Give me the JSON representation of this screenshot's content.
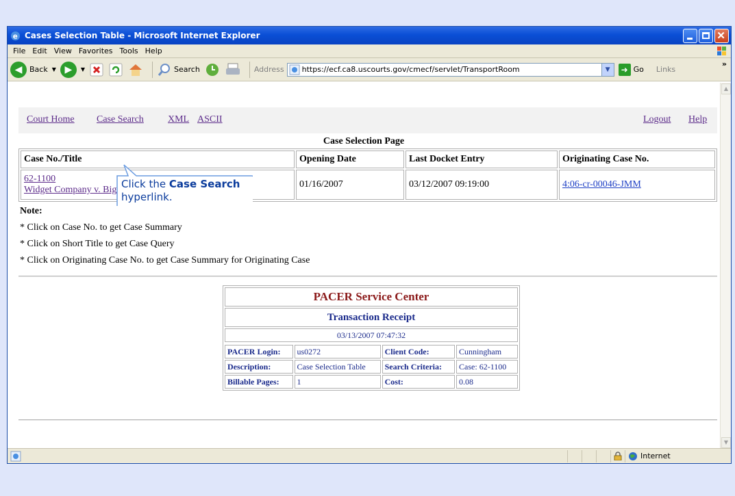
{
  "window": {
    "title": "Cases Selection Table - Microsoft Internet Explorer"
  },
  "menu": [
    "File",
    "Edit",
    "View",
    "Favorites",
    "Tools",
    "Help"
  ],
  "toolbar": {
    "back_label": "Back",
    "search_label": "Search",
    "address_label": "Address",
    "address_url": "https://ecf.ca8.uscourts.gov/cmecf/servlet/TransportRoom",
    "go_label": "Go",
    "links_label": "Links",
    "chevron": "»"
  },
  "nav": {
    "court_home": "Court Home",
    "case_search": "Case Search",
    "xml": "XML",
    "ascii": "ASCII",
    "logout": "Logout",
    "help": "Help"
  },
  "page_title": "Case Selection Page",
  "cases_table": {
    "headers": [
      "Case No./Title",
      "Opening Date",
      "Last Docket Entry",
      "Originating Case No."
    ],
    "row": {
      "case_no": "62-1100",
      "title": "Widget Company v. Big River Company",
      "opening_date": "01/16/2007",
      "last_docket_entry": "03/12/2007 09:19:00",
      "originating_case_no": "4:06-cr-00046-JMM"
    }
  },
  "notes": {
    "heading": "Note:",
    "items": [
      "* Click on Case No. to get Case Summary",
      "* Click on Short Title to get Case Query",
      "* Click on Originating Case No. to get Case Summary for Originating Case"
    ]
  },
  "receipt": {
    "title": "PACER Service Center",
    "subtitle": "Transaction Receipt",
    "date": "03/13/2007 07:47:32",
    "rows": [
      {
        "l1": "PACER Login:",
        "v1": "us0272",
        "l2": "Client Code:",
        "v2": "Cunningham"
      },
      {
        "l1": "Description:",
        "v1": "Case Selection Table",
        "l2": "Search Criteria:",
        "v2": "Case: 62-1100"
      },
      {
        "l1": "Billable Pages:",
        "v1": "1",
        "l2": "Cost:",
        "v2": "0.08"
      }
    ]
  },
  "callout": {
    "prefix": "Click the ",
    "bold": "Case Search",
    "suffix": " hyperlink."
  },
  "status": {
    "zone": "Internet"
  }
}
